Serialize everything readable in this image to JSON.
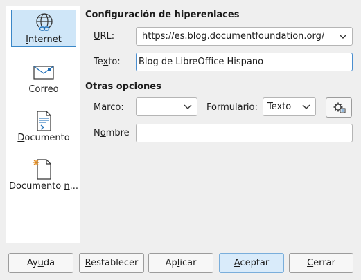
{
  "sidebar": {
    "items": [
      {
        "icon": "globe-link-icon",
        "label_pre": "",
        "label_mn": "I",
        "label_post": "nternet",
        "selected": true
      },
      {
        "icon": "envelope-icon",
        "label_pre": "",
        "label_mn": "C",
        "label_post": "orreo",
        "selected": false
      },
      {
        "icon": "document-icon",
        "label_pre": "",
        "label_mn": "D",
        "label_post": "ocumento",
        "selected": false
      },
      {
        "icon": "new-document-icon",
        "label_pre": "Documento ",
        "label_mn": "n",
        "label_post": "...",
        "selected": false
      }
    ]
  },
  "hyperlink_settings": {
    "title": "Configuración de hiperenlaces",
    "url_label_mn": "U",
    "url_label_rest": "RL:",
    "url_value": "https://es.blog.documentfoundation.org/",
    "text_label_pre": "Te",
    "text_label_mn": "x",
    "text_label_post": "to:",
    "text_value": "Blog de LibreOffice Hispano"
  },
  "other_options": {
    "title": "Otras opciones",
    "frame_label_mn": "M",
    "frame_label_rest": "arco:",
    "frame_value": "",
    "form_label_pre": "Form",
    "form_label_mn": "u",
    "form_label_post": "lario:",
    "form_value": "Texto",
    "name_label_pre": "N",
    "name_label_mn": "o",
    "name_label_post": "mbre",
    "name_value": ""
  },
  "buttons": {
    "help": {
      "pre": "Ay",
      "mn": "u",
      "post": "da"
    },
    "reset": {
      "pre": "",
      "mn": "R",
      "post": "establecer"
    },
    "apply": {
      "pre": "Ap",
      "mn": "l",
      "post": "icar"
    },
    "ok": {
      "pre": "",
      "mn": "A",
      "post": "ceptar"
    },
    "close": {
      "pre": "",
      "mn": "C",
      "post": "errar"
    }
  }
}
